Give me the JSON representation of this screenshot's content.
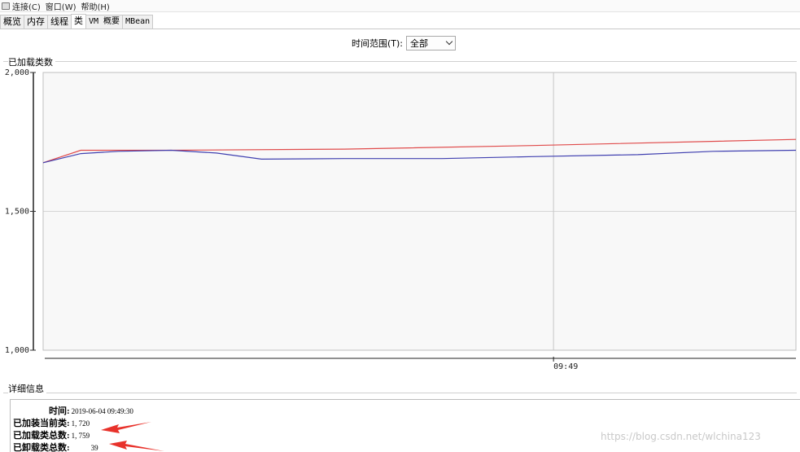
{
  "menubar": {
    "items": [
      "连接(C)",
      "窗口(W)",
      "帮助(H)"
    ]
  },
  "tabs": [
    {
      "label": "概览",
      "selected": false
    },
    {
      "label": "内存",
      "selected": false
    },
    {
      "label": "线程",
      "selected": false
    },
    {
      "label": "类",
      "selected": true
    },
    {
      "label": "VM 概要",
      "selected": false
    },
    {
      "label": "MBean",
      "selected": false
    }
  ],
  "time_range": {
    "label": "时间范围(T):",
    "selected": "全部"
  },
  "chart_section": {
    "title": "已加载类数"
  },
  "chart_data": {
    "type": "line",
    "title": "",
    "xlabel": "",
    "ylabel": "",
    "ylim": [
      1000,
      2000
    ],
    "y_ticks": [
      1000,
      1500,
      2000
    ],
    "y_tick_labels": [
      "1,000",
      "1,500",
      "2,000"
    ],
    "x_tick_labels": [
      "09:49"
    ],
    "grid": true,
    "series": [
      {
        "color": "#e04b4b",
        "x": [
          0,
          5,
          17,
          40,
          65,
          100
        ],
        "values": [
          1675,
          1720,
          1720,
          1724,
          1737,
          1759
        ]
      },
      {
        "color": "#4040b0",
        "x": [
          0,
          5,
          10,
          17,
          23,
          29,
          40,
          53,
          65,
          79,
          89,
          100
        ],
        "values": [
          1675,
          1708,
          1716,
          1720,
          1710,
          1688,
          1690,
          1690,
          1697,
          1704,
          1716,
          1720
        ]
      }
    ],
    "x_tick_at": 67.8
  },
  "details": {
    "title": "详细信息",
    "rows": [
      {
        "key": "时间:",
        "value": "2019-06-04 09:49:30"
      },
      {
        "key": "已加装当前类:",
        "value": "1, 720"
      },
      {
        "key": "已加载类总数:",
        "value": "1, 759"
      },
      {
        "key": "已卸载类总数:",
        "value": "39"
      }
    ]
  },
  "colors": {
    "arrow": "#e8322b",
    "plot_background": "#f8f8f8"
  },
  "watermark": "https://blog.csdn.net/wlchina123"
}
